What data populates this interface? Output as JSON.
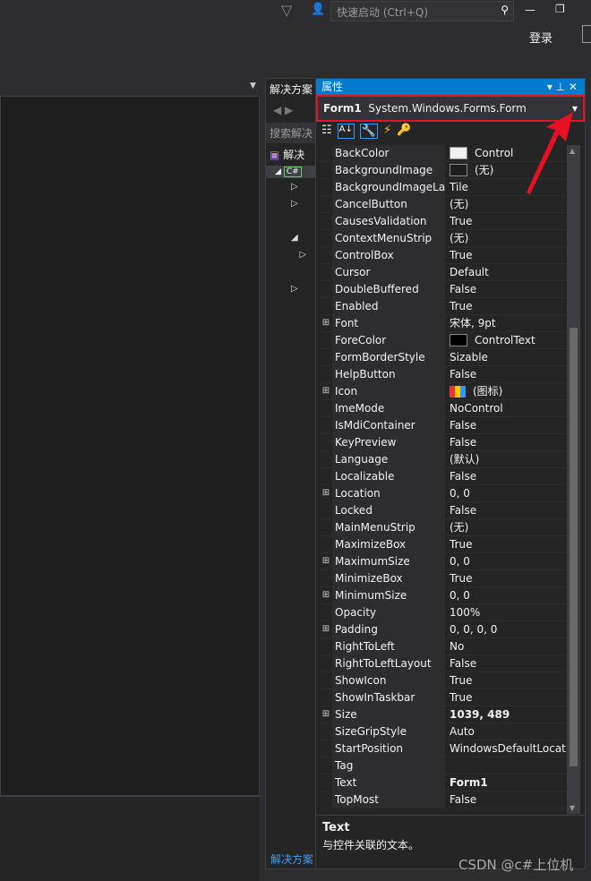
{
  "titlebar": {
    "quick_launch_placeholder": "快速启动 (Ctrl+Q)",
    "login": "登录"
  },
  "solution_explorer": {
    "title": "解决方案",
    "search": "搜索解决",
    "root": "解决",
    "footer_tab": "解决方案"
  },
  "properties": {
    "title": "属性",
    "object_name": "Form1",
    "object_type": "System.Windows.Forms.Form",
    "rows": [
      {
        "name": "BackColor",
        "value": "Control",
        "swatch": "#f0f0f0"
      },
      {
        "name": "BackgroundImage",
        "value": "(无)",
        "swatch": "#1e1e1e"
      },
      {
        "name": "BackgroundImageLayout",
        "value": "Tile"
      },
      {
        "name": "CancelButton",
        "value": "(无)"
      },
      {
        "name": "CausesValidation",
        "value": "True"
      },
      {
        "name": "ContextMenuStrip",
        "value": "(无)"
      },
      {
        "name": "ControlBox",
        "value": "True"
      },
      {
        "name": "Cursor",
        "value": "Default"
      },
      {
        "name": "DoubleBuffered",
        "value": "False"
      },
      {
        "name": "Enabled",
        "value": "True"
      },
      {
        "name": "Font",
        "value": "宋体, 9pt",
        "expand": true
      },
      {
        "name": "ForeColor",
        "value": "ControlText",
        "swatch": "#000000"
      },
      {
        "name": "FormBorderStyle",
        "value": "Sizable"
      },
      {
        "name": "HelpButton",
        "value": "False"
      },
      {
        "name": "Icon",
        "value": "(图标)",
        "expand": true,
        "icon": true
      },
      {
        "name": "ImeMode",
        "value": "NoControl"
      },
      {
        "name": "IsMdiContainer",
        "value": "False"
      },
      {
        "name": "KeyPreview",
        "value": "False"
      },
      {
        "name": "Language",
        "value": "(默认)"
      },
      {
        "name": "Localizable",
        "value": "False"
      },
      {
        "name": "Location",
        "value": "0, 0",
        "expand": true
      },
      {
        "name": "Locked",
        "value": "False"
      },
      {
        "name": "MainMenuStrip",
        "value": "(无)"
      },
      {
        "name": "MaximizeBox",
        "value": "True"
      },
      {
        "name": "MaximumSize",
        "value": "0, 0",
        "expand": true
      },
      {
        "name": "MinimizeBox",
        "value": "True"
      },
      {
        "name": "MinimumSize",
        "value": "0, 0",
        "expand": true
      },
      {
        "name": "Opacity",
        "value": "100%"
      },
      {
        "name": "Padding",
        "value": "0, 0, 0, 0",
        "expand": true
      },
      {
        "name": "RightToLeft",
        "value": "No"
      },
      {
        "name": "RightToLeftLayout",
        "value": "False"
      },
      {
        "name": "ShowIcon",
        "value": "True"
      },
      {
        "name": "ShowInTaskbar",
        "value": "True"
      },
      {
        "name": "Size",
        "value": "1039, 489",
        "expand": true,
        "bold": true
      },
      {
        "name": "SizeGripStyle",
        "value": "Auto"
      },
      {
        "name": "StartPosition",
        "value": "WindowsDefaultLocation"
      },
      {
        "name": "Tag",
        "value": ""
      },
      {
        "name": "Text",
        "value": "Form1",
        "bold": true
      },
      {
        "name": "TopMost",
        "value": "False"
      }
    ],
    "description_title": "Text",
    "description_text": "与控件关联的文本。"
  },
  "watermark": "CSDN @c#上位机",
  "colors": {
    "accent": "#007acc",
    "highlight": "#e81123"
  }
}
